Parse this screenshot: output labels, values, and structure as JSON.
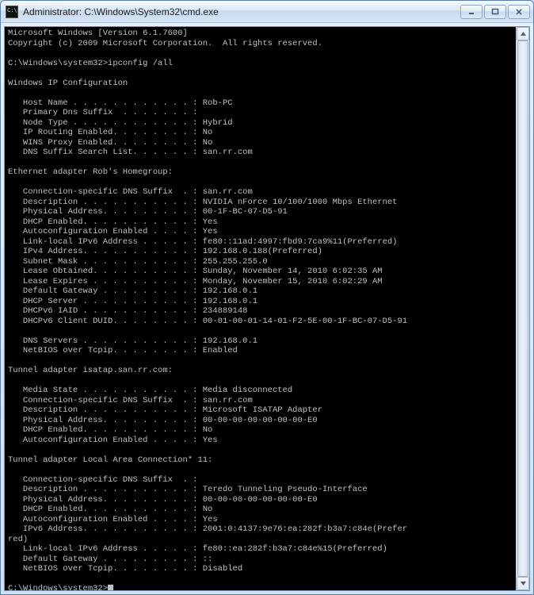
{
  "window": {
    "title": "Administrator: C:\\Windows\\System32\\cmd.exe"
  },
  "console": {
    "header_line1": "Microsoft Windows [Version 6.1.7600]",
    "header_line2": "Copyright (c) 2009 Microsoft Corporation.  All rights reserved.",
    "prompt1": "C:\\Windows\\system32>ipconfig /all",
    "section_ip": "Windows IP Configuration",
    "ip_config": {
      "host_name": "   Host Name . . . . . . . . . . . . : Rob-PC",
      "primary_dns_suffix": "   Primary Dns Suffix  . . . . . . . :",
      "node_type": "   Node Type . . . . . . . . . . . . : Hybrid",
      "ip_routing": "   IP Routing Enabled. . . . . . . . : No",
      "wins_proxy": "   WINS Proxy Enabled. . . . . . . . : No",
      "dns_suffix_search": "   DNS Suffix Search List. . . . . . : san.rr.com"
    },
    "section_eth": "Ethernet adapter Rob's Homegroup:",
    "eth": {
      "conn_dns": "   Connection-specific DNS Suffix  . : san.rr.com",
      "description": "   Description . . . . . . . . . . . : NVIDIA nForce 10/100/1000 Mbps Ethernet",
      "physical": "   Physical Address. . . . . . . . . : 00-1F-BC-07-D5-91",
      "dhcp_enabled": "   DHCP Enabled. . . . . . . . . . . : Yes",
      "autoconf": "   Autoconfiguration Enabled . . . . : Yes",
      "link_local_ipv6": "   Link-local IPv6 Address . . . . . : fe80::11ad:4997:fbd9:7ca9%11(Preferred)",
      "ipv4": "   IPv4 Address. . . . . . . . . . . : 192.168.0.188(Preferred)",
      "subnet": "   Subnet Mask . . . . . . . . . . . : 255.255.255.0",
      "lease_obtained": "   Lease Obtained. . . . . . . . . . : Sunday, November 14, 2010 6:02:35 AM",
      "lease_expires": "   Lease Expires . . . . . . . . . . : Monday, November 15, 2010 6:02:29 AM",
      "default_gateway": "   Default Gateway . . . . . . . . . : 192.168.0.1",
      "dhcp_server": "   DHCP Server . . . . . . . . . . . : 192.168.0.1",
      "dhcpv6_iaid": "   DHCPv6 IAID . . . . . . . . . . . : 234889148",
      "dhcpv6_duid": "   DHCPv6 Client DUID. . . . . . . . : 00-01-00-01-14-01-F2-5E-00-1F-BC-07-D5-91",
      "blank": "",
      "dns_servers": "   DNS Servers . . . . . . . . . . . : 192.168.0.1",
      "netbios": "   NetBIOS over Tcpip. . . . . . . . : Enabled"
    },
    "section_isatap": "Tunnel adapter isatap.san.rr.com:",
    "isatap": {
      "media_state": "   Media State . . . . . . . . . . . : Media disconnected",
      "conn_dns": "   Connection-specific DNS Suffix  . : san.rr.com",
      "description": "   Description . . . . . . . . . . . : Microsoft ISATAP Adapter",
      "physical": "   Physical Address. . . . . . . . . : 00-00-00-00-00-00-00-E0",
      "dhcp_enabled": "   DHCP Enabled. . . . . . . . . . . : No",
      "autoconf": "   Autoconfiguration Enabled . . . . : Yes"
    },
    "section_tunnel11": "Tunnel adapter Local Area Connection* 11:",
    "tunnel11": {
      "conn_dns": "   Connection-specific DNS Suffix  . :",
      "description": "   Description . . . . . . . . . . . : Teredo Tunneling Pseudo-Interface",
      "physical": "   Physical Address. . . . . . . . . : 00-00-00-00-00-00-00-E0",
      "dhcp_enabled": "   DHCP Enabled. . . . . . . . . . . : No",
      "autoconf": "   Autoconfiguration Enabled . . . . : Yes",
      "ipv6_a": "   IPv6 Address. . . . . . . . . . . : 2001:0:4137:9e76:ea:282f:b3a7:c84e(Prefer",
      "ipv6_b": "red)",
      "link_local_ipv6": "   Link-local IPv6 Address . . . . . : fe80::ea:282f:b3a7:c84e%15(Preferred)",
      "default_gateway": "   Default Gateway . . . . . . . . . : ::",
      "netbios": "   NetBIOS over Tcpip. . . . . . . . : Disabled"
    },
    "prompt2": "C:\\Windows\\system32>"
  }
}
